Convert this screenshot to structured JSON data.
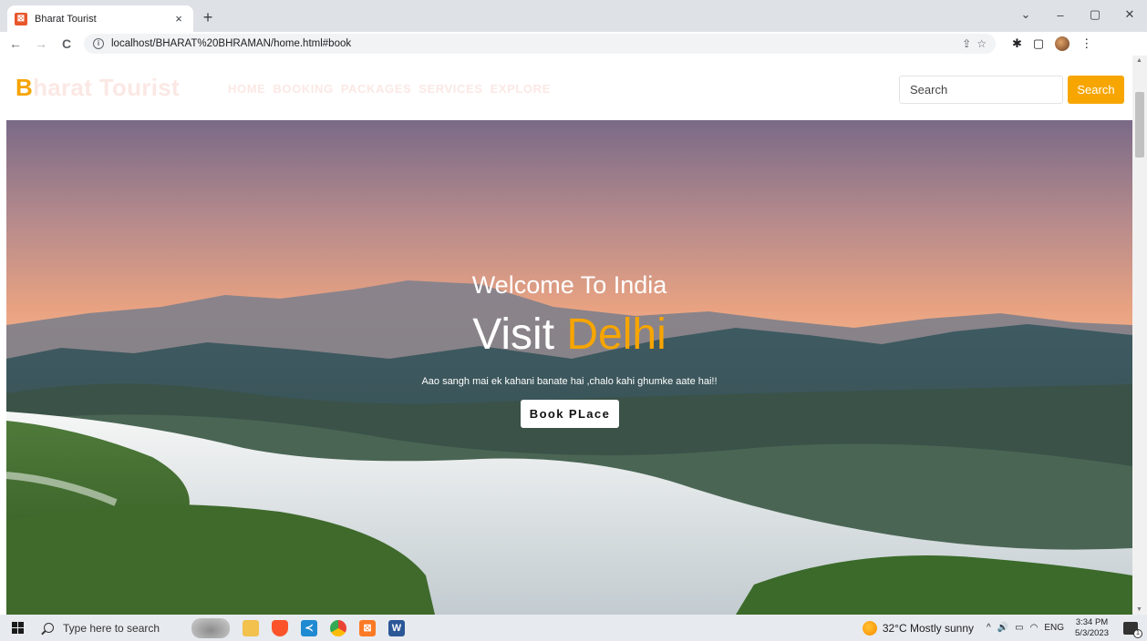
{
  "browser": {
    "tab_title": "Bharat Tourist",
    "tab_favicon_glyph": "⊠",
    "url": "localhost/BHARAT%20BHRAMAN/home.html#book",
    "icons": {
      "back": "←",
      "forward": "→",
      "reload": "C",
      "info": "i",
      "share": "⇪",
      "bookmark": "☆",
      "extensions": "✱",
      "sidepanel": "▢",
      "close_tab": "×",
      "new_tab": "+",
      "menu": "⋮",
      "minimize": "–",
      "restore": "▢",
      "close_window": "✕",
      "tab_list": "⌄"
    }
  },
  "site": {
    "brand_first": "B",
    "brand_rest": "harat Tourist",
    "nav": [
      "HOME",
      "BOOKING",
      "PACKAGES",
      "SERVICES",
      "EXPLORE"
    ],
    "search_placeholder": "Search",
    "search_button": "Search",
    "colors": {
      "accent": "#f7a500",
      "nav_text": "#fbe8e4"
    }
  },
  "hero": {
    "subtitle": "Welcome To India",
    "title_part1": "Visit ",
    "title_part2": "Delhi",
    "tagline": "Aao sangh mai ek kahani banate hai ,chalo kahi ghumke aate hai!!",
    "button": "Book PLace"
  },
  "taskbar": {
    "search_placeholder": "Type here to search",
    "weather": "32°C  Mostly sunny",
    "tray": {
      "chevron": "^",
      "volume": "🔊",
      "battery": "▭",
      "wifi": "◠",
      "lang": "ENG"
    },
    "time": "3:34 PM",
    "date": "5/3/2023",
    "notification_count": "1",
    "app_glyphs": {
      "vscode": "≺",
      "word": "W",
      "xampp": "⊠"
    }
  },
  "scrollbar": {
    "up": "▲",
    "down": "▼"
  }
}
